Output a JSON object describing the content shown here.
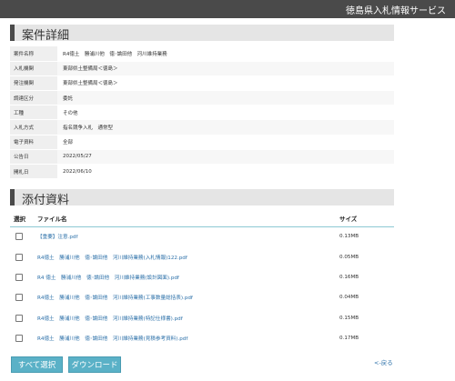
{
  "header": {
    "site_title": "徳島県入札情報サービス"
  },
  "details": {
    "title": "案件詳細",
    "rows": [
      {
        "label": "案件名称",
        "value": "R4徳土　勝浦川他　徳･論田他　河川維持業務"
      },
      {
        "label": "入札機関",
        "value": "東部県土整備局＜徳島＞"
      },
      {
        "label": "発注機関",
        "value": "東部県土整備局＜徳島＞"
      },
      {
        "label": "調達区分",
        "value": "委託"
      },
      {
        "label": "工種",
        "value": "その他"
      },
      {
        "label": "入札方式",
        "value": "指名競争入札　通常型"
      },
      {
        "label": "電子資料",
        "value": "全部"
      },
      {
        "label": "公告日",
        "value": "2022/05/27"
      },
      {
        "label": "開札日",
        "value": "2022/06/10"
      }
    ]
  },
  "attachments": {
    "title": "添付資料",
    "columns": {
      "select": "選択",
      "filename": "ファイル名",
      "size": "サイズ"
    },
    "files": [
      {
        "name": "【重要】注意.pdf",
        "size": "0.13MB"
      },
      {
        "name": "R4徳土　勝浦川他　徳･論田他　河川維持業務(入札情報)122.pdf",
        "size": "0.05MB"
      },
      {
        "name": "R4 徳土　勝浦川他　徳･論田他　河川維持業務(設計図面).pdf",
        "size": "0.16MB"
      },
      {
        "name": "R4徳土　勝浦川他　徳･論田他　河川維持業務(工事数量総括表).pdf",
        "size": "0.04MB"
      },
      {
        "name": "R4徳土　勝浦川他　徳･論田他　河川維持業務(特記仕様書).pdf",
        "size": "0.15MB"
      },
      {
        "name": "R4徳土　勝浦川他　徳･論田他　河川維持業務(見積参考資料).pdf",
        "size": "0.17MB"
      }
    ]
  },
  "actions": {
    "select_all": "すべて選択",
    "download": "ダウンロード",
    "back": "<-戻る"
  }
}
